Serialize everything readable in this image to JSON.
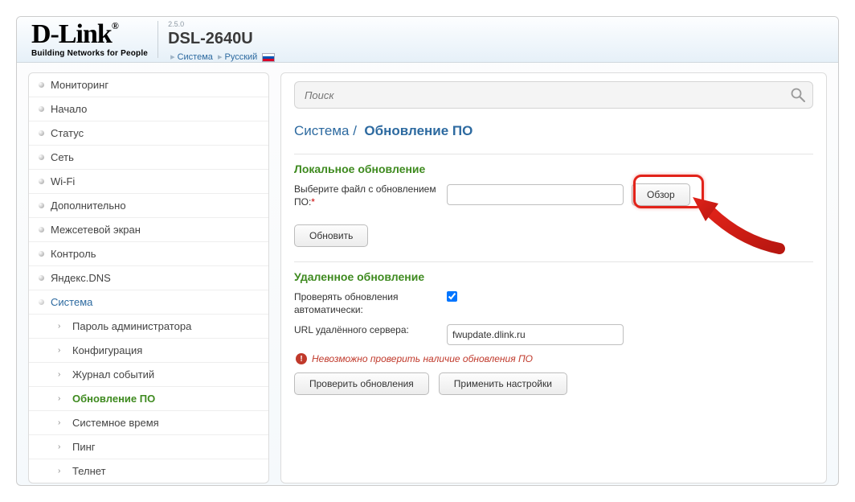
{
  "header": {
    "logo_brand": "D-Link",
    "logo_tagline": "Building Networks for People",
    "version": "2.5.0",
    "model": "DSL-2640U",
    "crumb1": "Система",
    "crumb2": "Русский"
  },
  "search": {
    "placeholder": "Поиск"
  },
  "sidebar": {
    "items": [
      {
        "label": "Мониторинг"
      },
      {
        "label": "Начало"
      },
      {
        "label": "Статус"
      },
      {
        "label": "Сеть"
      },
      {
        "label": "Wi-Fi"
      },
      {
        "label": "Дополнительно"
      },
      {
        "label": "Межсетевой экран"
      },
      {
        "label": "Контроль"
      },
      {
        "label": "Яндекс.DNS"
      },
      {
        "label": "Система"
      }
    ],
    "sub": [
      {
        "label": "Пароль администратора"
      },
      {
        "label": "Конфигурация"
      },
      {
        "label": "Журнал событий"
      },
      {
        "label": "Обновление ПО"
      },
      {
        "label": "Системное время"
      },
      {
        "label": "Пинг"
      },
      {
        "label": "Телнет"
      }
    ]
  },
  "page": {
    "title_cat": "Система",
    "title_sep": "/",
    "title_page": "Обновление ПО"
  },
  "local": {
    "heading": "Локальное обновление",
    "choose_label": "Выберите файл с обновлением ПО:",
    "browse": "Обзор",
    "update": "Обновить"
  },
  "remote": {
    "heading": "Удаленное обновление",
    "auto_label": "Проверять обновления автоматически:",
    "url_label": "URL удалённого сервера:",
    "url_value": "fwupdate.dlink.ru",
    "error": "Невозможно проверить наличие обновления ПО",
    "check": "Проверить обновления",
    "apply": "Применить настройки"
  }
}
